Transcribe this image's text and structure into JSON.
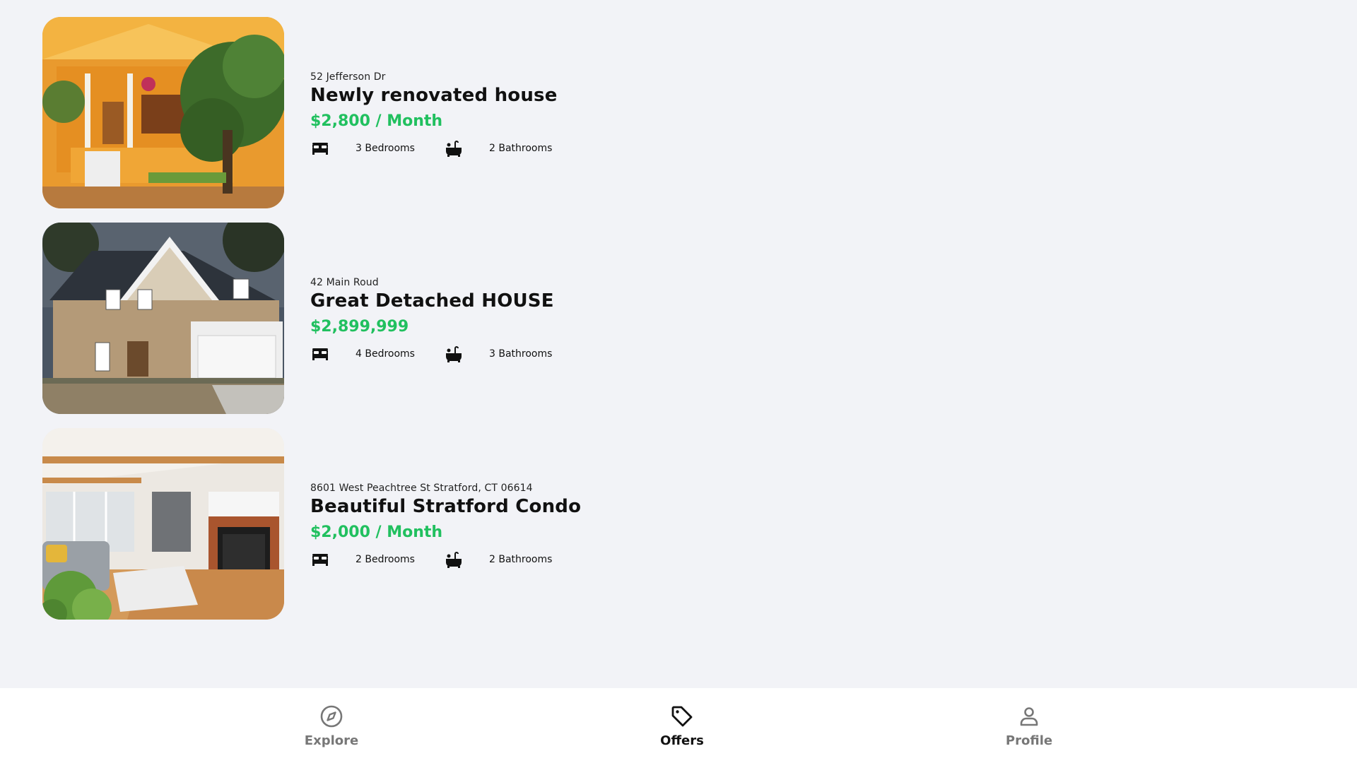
{
  "colors": {
    "accent_price": "#21c05f",
    "background": "#f2f3f7",
    "nav_inactive": "#777777",
    "nav_active": "#111111"
  },
  "listings": [
    {
      "address": "52 Jefferson Dr",
      "title": "Newly renovated house",
      "price": "$2,800 / Month",
      "bedrooms": "3 Bedrooms",
      "bathrooms": "2 Bathrooms",
      "bed_icon": "bed-icon",
      "bath_icon": "bathtub-icon"
    },
    {
      "address": "42 Main Roud",
      "title": "Great Detached HOUSE",
      "price": "$2,899,999",
      "bedrooms": "4 Bedrooms",
      "bathrooms": "3 Bathrooms",
      "bed_icon": "bed-icon",
      "bath_icon": "bathtub-icon"
    },
    {
      "address": "8601 West Peachtree St Stratford, CT 06614",
      "title": "Beautiful Stratford Condo",
      "price": "$2,000 / Month",
      "bedrooms": "2 Bedrooms",
      "bathrooms": "2 Bathrooms",
      "bed_icon": "bed-icon",
      "bath_icon": "bathtub-icon"
    }
  ],
  "nav": {
    "items": [
      {
        "label": "Explore",
        "icon": "compass-icon",
        "active": false
      },
      {
        "label": "Offers",
        "icon": "tag-icon",
        "active": true
      },
      {
        "label": "Profile",
        "icon": "user-icon",
        "active": false
      }
    ]
  }
}
